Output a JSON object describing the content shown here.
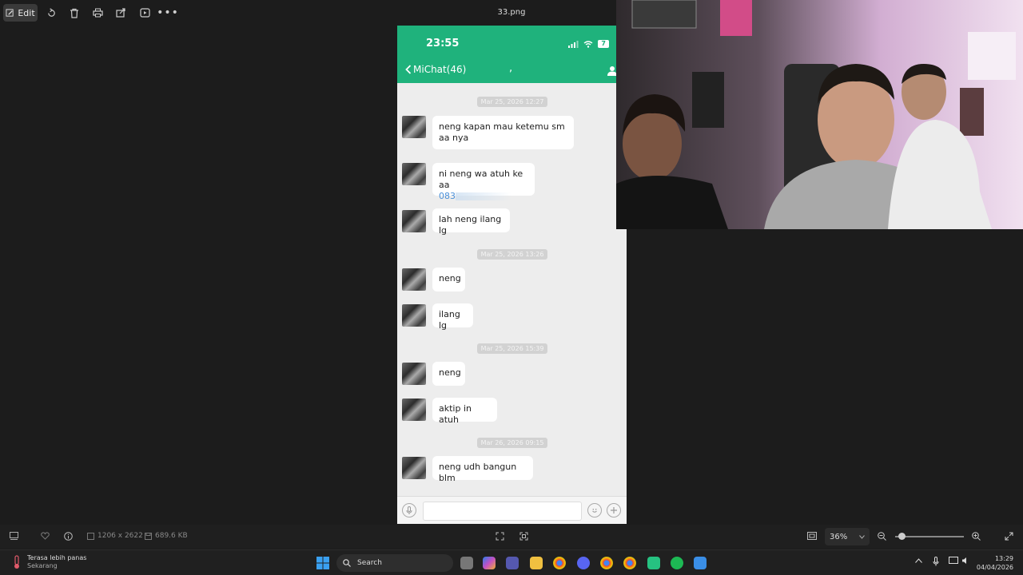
{
  "toolbar": {
    "edit_label": "Edit",
    "file_title": "33.png"
  },
  "phone": {
    "time": "23:55",
    "battery": "7",
    "back_label": "MiChat(46)",
    "contact_name": ",",
    "messages": [
      {
        "timestamp": "Mar 25, 2026 12:27",
        "texts": [
          "neng kapan mau ketemu sm aa nya",
          "ni neng wa atuh ke aa",
          "lah neng ilang lg"
        ],
        "phone_partial": "083"
      },
      {
        "timestamp": "Mar 25, 2026 13:26",
        "texts": [
          "neng",
          "ilang lg"
        ]
      },
      {
        "timestamp": "Mar 25, 2026 15:39",
        "texts": [
          "neng",
          "aktip in atuh"
        ]
      },
      {
        "timestamp": "Mar 26, 2026 09:15",
        "texts": [
          "neng udh bangun blm"
        ]
      }
    ]
  },
  "bottombar": {
    "dimensions": "1206 x 2622",
    "file_size": "689.6 KB",
    "zoom": "36%"
  },
  "taskbar": {
    "weather_title": "Terasa lebih panas",
    "weather_sub": "Sekarang",
    "search_placeholder": "Search",
    "time": "13:29",
    "date": "04/04/2026"
  },
  "colors": {
    "app_green": "#1fb27c",
    "background": "#1c1c1c",
    "link_blue": "#4a90d9"
  }
}
